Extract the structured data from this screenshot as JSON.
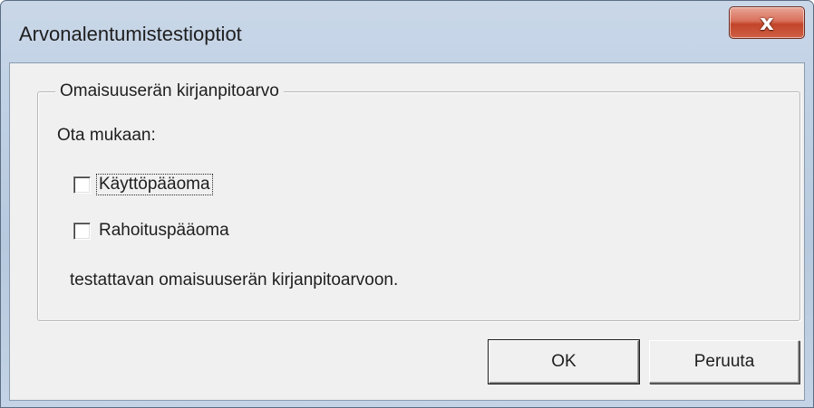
{
  "window": {
    "title": "Arvonalentumistestioptiot",
    "close_glyph": "x"
  },
  "group": {
    "legend": "Omaisuuserän kirjanpitoarvo",
    "intro": "Ota mukaan:",
    "options": [
      {
        "label": "Käyttöpääoma",
        "checked": false,
        "focused": true
      },
      {
        "label": "Rahoituspääoma",
        "checked": false,
        "focused": false
      }
    ],
    "footer": "testattavan omaisuuserän kirjanpitoarvoon."
  },
  "buttons": {
    "ok_label": "OK",
    "cancel_label": "Peruuta"
  },
  "icons": {
    "close": "close-icon",
    "checkbox": "checkbox-icon"
  },
  "colors": {
    "close_button": "#c9523a",
    "title_bar": "#bfd0e4",
    "client_bg": "#f0f0f0"
  }
}
